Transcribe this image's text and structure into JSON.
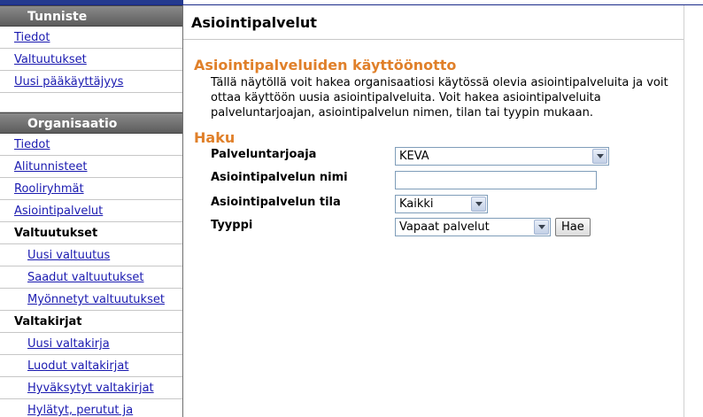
{
  "sidebar": {
    "sections": [
      {
        "title": "Tunniste",
        "items": [
          "Tiedot",
          "Valtuutukset",
          "Uusi pääkäyttäjyys"
        ]
      },
      {
        "title": "Organisaatio",
        "items": [
          "Tiedot",
          "Alitunnisteet",
          "Rooliryhmät",
          "Asiointipalvelut"
        ],
        "groups": [
          {
            "label": "Valtuutukset",
            "items": [
              "Uusi valtuutus",
              "Saadut valtuutukset",
              "Myönnetyt valtuutukset"
            ]
          },
          {
            "label": "Valtakirjat",
            "items": [
              "Uusi valtakirja",
              "Luodut valtakirjat",
              "Hyväksytyt valtakirjat",
              "Hylätyt, perutut ja"
            ]
          }
        ]
      }
    ]
  },
  "main": {
    "page_title": "Asiointipalvelut",
    "section_title": "Asiointipalveluiden käyttöönotto",
    "intro": "Tällä näytöllä voit hakea organisaatiosi käytössä olevia asiointipalveluita ja voit ottaa käyttöön uusia asiointipalveluita. Voit hakea asiointipalveluita palveluntarjoajan, asiointipalvelun nimen, tilan tai tyypin mukaan.",
    "search_title": "Haku",
    "form": {
      "provider_label": "Palveluntarjoaja",
      "provider_value": "KEVA",
      "name_label": "Asiointipalvelun nimi",
      "name_value": "",
      "state_label": "Asiointipalvelun tila",
      "state_value": "Kaikki",
      "type_label": "Tyyppi",
      "type_value": "Vapaat palvelut",
      "search_button": "Hae"
    }
  },
  "colors": {
    "accent": "#e0802a",
    "link": "#1a1ab0",
    "sidebar_header": "#6f6f6f"
  }
}
